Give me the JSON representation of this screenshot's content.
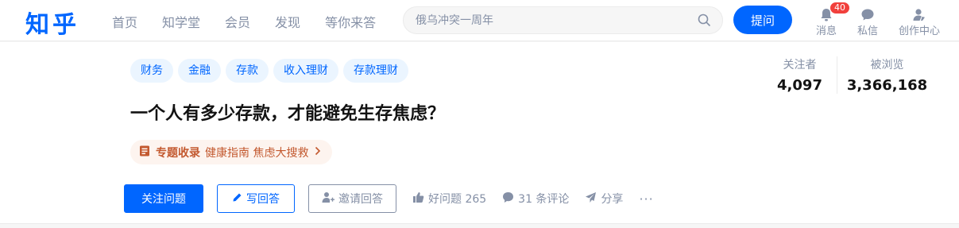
{
  "header": {
    "logo": "知乎",
    "nav": [
      "首页",
      "知学堂",
      "会员",
      "发现",
      "等你来答"
    ],
    "search_placeholder": "俄乌冲突一周年",
    "ask_label": "提问",
    "messages": {
      "label": "消息",
      "badge": "40"
    },
    "dm_label": "私信",
    "creator_label": "创作中心"
  },
  "question": {
    "topics": [
      "财务",
      "金融",
      "存款",
      "收入理财",
      "存款理财"
    ],
    "title": "一个人有多少存款，才能避免生存焦虑？",
    "collection": {
      "prefix": "专题收录",
      "items": "健康指南 焦虑大搜救"
    },
    "stats": {
      "followers_label": "关注者",
      "followers": "4,097",
      "views_label": "被浏览",
      "views": "3,366,168"
    },
    "actions": {
      "follow": "关注问题",
      "write": "写回答",
      "invite": "邀请回答",
      "good_question": "好问题 265",
      "comments": "31 条评论",
      "share": "分享",
      "more": "···"
    }
  },
  "colors": {
    "accent": "#0066ff",
    "muted": "#8590a6",
    "collection": "#c3592f",
    "badge": "#f1403c"
  }
}
